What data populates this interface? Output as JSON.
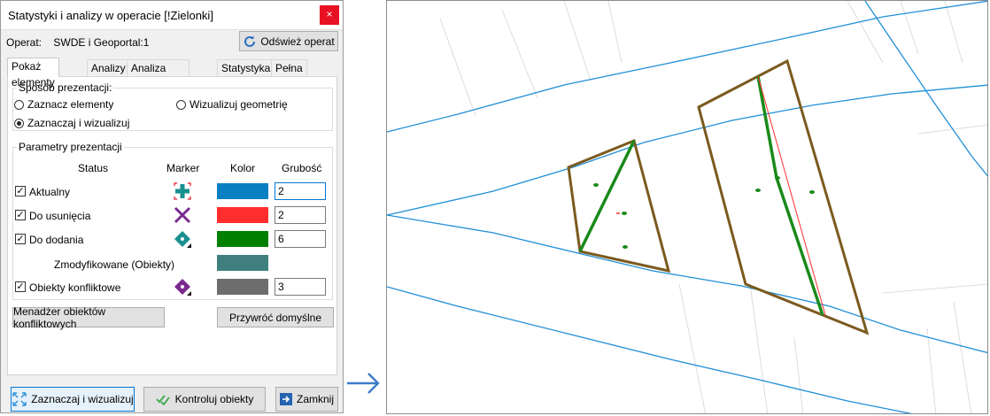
{
  "window": {
    "title": "Statystyki i analizy w operacie [!Zielonki]",
    "close_glyph": "×"
  },
  "operat": {
    "label": "Operat:",
    "value": "SWDE i Geoportal:1",
    "refresh_button": "Odśwież operat"
  },
  "tabs": [
    "Pokaż elementy",
    "Analizy",
    "Analiza przylegania",
    "Statystyka",
    "Pełna lista"
  ],
  "active_tab": 0,
  "presentation_mode": {
    "legend": "Sposób prezentacji:",
    "options": [
      "Zaznacz elementy",
      "Wizualizuj geometrię",
      "Zaznaczaj i wizualizuj"
    ],
    "selected": 2
  },
  "presentation_params": {
    "legend": "Parametry prezentacji",
    "headers": {
      "status": "Status",
      "marker": "Marker",
      "color": "Kolor",
      "thickness": "Grubość"
    },
    "rows": [
      {
        "label": "Aktualny",
        "has_checkbox": true,
        "checked": true,
        "marker_icon": "plus-marker-icon",
        "color": "#0a7fc2",
        "thickness": "2",
        "focused": true
      },
      {
        "label": "Do usunięcia",
        "has_checkbox": true,
        "checked": true,
        "marker_icon": "x-marker-icon",
        "color": "#ff2d2d",
        "thickness": "2",
        "focused": false
      },
      {
        "label": "Do dodania",
        "has_checkbox": true,
        "checked": true,
        "marker_icon": "diamond-marker-teal-icon",
        "color": "#008000",
        "thickness": "6",
        "focused": false
      },
      {
        "label": "Zmodyfikowane (Obiekty)",
        "has_checkbox": false,
        "checked": false,
        "marker_icon": "",
        "color": "#3f807f",
        "thickness": "",
        "focused": false
      },
      {
        "label": "Obiekty konfliktowe",
        "has_checkbox": true,
        "checked": true,
        "marker_icon": "diamond-marker-purple-icon",
        "color": "#6d6d6d",
        "thickness": "3",
        "focused": false
      }
    ]
  },
  "buttons": {
    "conflict_manager": "Menadżer obiektów konfliktowych",
    "restore_defaults": "Przywróć domyślne",
    "select_visualize": "Zaznaczaj i wizualizuj",
    "check_objects": "Kontroluj obiekty",
    "close": "Zamknij"
  },
  "colors": {
    "accent": "#0078d7",
    "map_line": "#1f8fd6",
    "parcel_outline": "#7b5a1e",
    "added_line": "#1a8a1a",
    "removed_line": "#ff2d2d"
  }
}
